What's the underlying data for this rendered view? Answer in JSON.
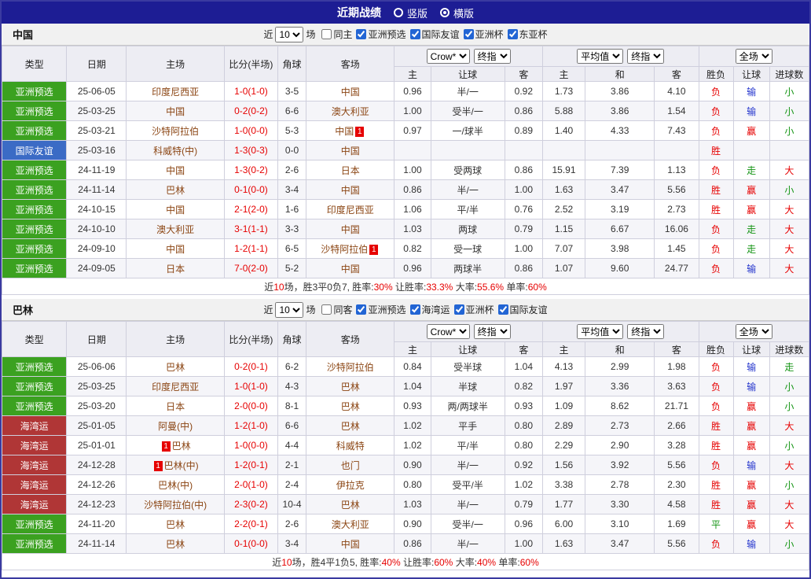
{
  "topbar": {
    "title": "近期战绩",
    "view_modes": [
      {
        "label": "竖版",
        "selected": false
      },
      {
        "label": "横版",
        "selected": true
      }
    ]
  },
  "labels": {
    "recent": "近",
    "matches": "场"
  },
  "headers": {
    "col_type": "类型",
    "col_date": "日期",
    "col_home": "主场",
    "col_score": "比分(半场)",
    "col_corner": "角球",
    "col_away": "客场",
    "odds_source": "Crow*",
    "odds_kind": "终指",
    "avg_source": "平均值",
    "avg_kind": "终指",
    "fulltime": "全场",
    "sub": [
      "主",
      "让球",
      "客",
      "主",
      "和",
      "客",
      "胜负",
      "让球",
      "进球数"
    ]
  },
  "colors": {
    "topbar_bg": "#1d1d94",
    "outer_border": "#3a3aa0",
    "header_bg": "#ededf3",
    "strip_bg": "#f1f1f1",
    "row_alt_bg": "#f5f5f9",
    "grid_line": "#cfcfdd",
    "type_green": "#3ba120",
    "type_blue": "#3b6bc5",
    "type_red": "#b03636",
    "team_link": "#8b4513",
    "score_red": "#e60000",
    "result_red": "#e60000",
    "result_blue": "#2233cc",
    "result_green": "#149414",
    "label_dark": "#333333",
    "checkbox_accent": "#2265d4"
  },
  "sections": [
    {
      "title": "中国",
      "filter": {
        "recent_count": "10",
        "options": [
          {
            "label": "同主",
            "checked": false
          },
          {
            "label": "亚洲预选",
            "checked": true
          },
          {
            "label": "国际友谊",
            "checked": true
          },
          {
            "label": "亚洲杯",
            "checked": true
          },
          {
            "label": "东亚杯",
            "checked": true
          }
        ]
      },
      "rows": [
        {
          "type": "亚洲预选",
          "type_color": "green",
          "date": "25-06-05",
          "home_name": "印度尼西亚",
          "home_rc": "",
          "score": "1-0(1-0)",
          "corner": "3-5",
          "away_name": "中国",
          "away_rc": "",
          "odds": [
            "0.96",
            "半/一",
            "0.92"
          ],
          "avg": [
            "1.73",
            "3.86",
            "4.10"
          ],
          "results": [
            [
              "负",
              "r"
            ],
            [
              "输",
              "b"
            ],
            [
              "小",
              "g"
            ]
          ]
        },
        {
          "type": "亚洲预选",
          "type_color": "green",
          "date": "25-03-25",
          "home_name": "中国",
          "home_rc": "",
          "score": "0-2(0-2)",
          "corner": "6-6",
          "away_name": "澳大利亚",
          "away_rc": "",
          "odds": [
            "1.00",
            "受半/一",
            "0.86"
          ],
          "avg": [
            "5.88",
            "3.86",
            "1.54"
          ],
          "results": [
            [
              "负",
              "r"
            ],
            [
              "输",
              "b"
            ],
            [
              "小",
              "g"
            ]
          ]
        },
        {
          "type": "亚洲预选",
          "type_color": "green",
          "date": "25-03-21",
          "home_name": "沙特阿拉伯",
          "home_rc": "",
          "score": "1-0(0-0)",
          "corner": "5-3",
          "away_name": "中国",
          "away_rc": "after",
          "odds": [
            "0.97",
            "一/球半",
            "0.89"
          ],
          "avg": [
            "1.40",
            "4.33",
            "7.43"
          ],
          "results": [
            [
              "负",
              "r"
            ],
            [
              "赢",
              "r"
            ],
            [
              "小",
              "g"
            ]
          ]
        },
        {
          "type": "国际友谊",
          "type_color": "blue",
          "date": "25-03-16",
          "home_name": "科威特(中)",
          "home_rc": "",
          "score": "1-3(0-3)",
          "corner": "0-0",
          "away_name": "中国",
          "away_rc": "",
          "odds": [
            "",
            "",
            ""
          ],
          "avg": [
            "",
            "",
            ""
          ],
          "results": [
            [
              "胜",
              "r"
            ],
            [
              "",
              ""
            ],
            [
              "",
              ""
            ]
          ]
        },
        {
          "type": "亚洲预选",
          "type_color": "green",
          "date": "24-11-19",
          "home_name": "中国",
          "home_rc": "",
          "score": "1-3(0-2)",
          "corner": "2-6",
          "away_name": "日本",
          "away_rc": "",
          "odds": [
            "1.00",
            "受两球",
            "0.86"
          ],
          "avg": [
            "15.91",
            "7.39",
            "1.13"
          ],
          "results": [
            [
              "负",
              "r"
            ],
            [
              "走",
              "g"
            ],
            [
              "大",
              "r"
            ]
          ]
        },
        {
          "type": "亚洲预选",
          "type_color": "green",
          "date": "24-11-14",
          "home_name": "巴林",
          "home_rc": "",
          "score": "0-1(0-0)",
          "corner": "3-4",
          "away_name": "中国",
          "away_rc": "",
          "odds": [
            "0.86",
            "半/一",
            "1.00"
          ],
          "avg": [
            "1.63",
            "3.47",
            "5.56"
          ],
          "results": [
            [
              "胜",
              "r"
            ],
            [
              "赢",
              "r"
            ],
            [
              "小",
              "g"
            ]
          ]
        },
        {
          "type": "亚洲预选",
          "type_color": "green",
          "date": "24-10-15",
          "home_name": "中国",
          "home_rc": "",
          "score": "2-1(2-0)",
          "corner": "1-6",
          "away_name": "印度尼西亚",
          "away_rc": "",
          "odds": [
            "1.06",
            "平/半",
            "0.76"
          ],
          "avg": [
            "2.52",
            "3.19",
            "2.73"
          ],
          "results": [
            [
              "胜",
              "r"
            ],
            [
              "赢",
              "r"
            ],
            [
              "大",
              "r"
            ]
          ]
        },
        {
          "type": "亚洲预选",
          "type_color": "green",
          "date": "24-10-10",
          "home_name": "澳大利亚",
          "home_rc": "",
          "score": "3-1(1-1)",
          "corner": "3-3",
          "away_name": "中国",
          "away_rc": "",
          "odds": [
            "1.03",
            "两球",
            "0.79"
          ],
          "avg": [
            "1.15",
            "6.67",
            "16.06"
          ],
          "results": [
            [
              "负",
              "r"
            ],
            [
              "走",
              "g"
            ],
            [
              "大",
              "r"
            ]
          ]
        },
        {
          "type": "亚洲预选",
          "type_color": "green",
          "date": "24-09-10",
          "home_name": "中国",
          "home_rc": "",
          "score": "1-2(1-1)",
          "corner": "6-5",
          "away_name": "沙特阿拉伯",
          "away_rc": "after",
          "odds": [
            "0.82",
            "受一球",
            "1.00"
          ],
          "avg": [
            "7.07",
            "3.98",
            "1.45"
          ],
          "results": [
            [
              "负",
              "r"
            ],
            [
              "走",
              "g"
            ],
            [
              "大",
              "r"
            ]
          ]
        },
        {
          "type": "亚洲预选",
          "type_color": "green",
          "date": "24-09-05",
          "home_name": "日本",
          "home_rc": "",
          "score": "7-0(2-0)",
          "corner": "5-2",
          "away_name": "中国",
          "away_rc": "",
          "odds": [
            "0.96",
            "两球半",
            "0.86"
          ],
          "avg": [
            "1.07",
            "9.60",
            "24.77"
          ],
          "results": [
            [
              "负",
              "r"
            ],
            [
              "输",
              "b"
            ],
            [
              "大",
              "r"
            ]
          ]
        }
      ],
      "summary": [
        {
          "text": "近",
          "color": "#333333"
        },
        {
          "text": "10",
          "color": "#e60000"
        },
        {
          "text": "场，胜3平0负7, 胜率:",
          "color": "#333333"
        },
        {
          "text": "30%",
          "color": "#e60000"
        },
        {
          "text": " 让胜率:",
          "color": "#333333"
        },
        {
          "text": "33.3%",
          "color": "#e60000"
        },
        {
          "text": " 大率:",
          "color": "#333333"
        },
        {
          "text": "55.6%",
          "color": "#e60000"
        },
        {
          "text": " 单率:",
          "color": "#333333"
        },
        {
          "text": "60%",
          "color": "#e60000"
        }
      ]
    },
    {
      "title": "巴林",
      "filter": {
        "recent_count": "10",
        "options": [
          {
            "label": "同客",
            "checked": false
          },
          {
            "label": "亚洲预选",
            "checked": true
          },
          {
            "label": "海湾运",
            "checked": true
          },
          {
            "label": "亚洲杯",
            "checked": true
          },
          {
            "label": "国际友谊",
            "checked": true
          }
        ]
      },
      "rows": [
        {
          "type": "亚洲预选",
          "type_color": "green",
          "date": "25-06-06",
          "home_name": "巴林",
          "home_rc": "",
          "score": "0-2(0-1)",
          "corner": "6-2",
          "away_name": "沙特阿拉伯",
          "away_rc": "",
          "odds": [
            "0.84",
            "受半球",
            "1.04"
          ],
          "avg": [
            "4.13",
            "2.99",
            "1.98"
          ],
          "results": [
            [
              "负",
              "r"
            ],
            [
              "输",
              "b"
            ],
            [
              "走",
              "g"
            ]
          ]
        },
        {
          "type": "亚洲预选",
          "type_color": "green",
          "date": "25-03-25",
          "home_name": "印度尼西亚",
          "home_rc": "",
          "score": "1-0(1-0)",
          "corner": "4-3",
          "away_name": "巴林",
          "away_rc": "",
          "odds": [
            "1.04",
            "半球",
            "0.82"
          ],
          "avg": [
            "1.97",
            "3.36",
            "3.63"
          ],
          "results": [
            [
              "负",
              "r"
            ],
            [
              "输",
              "b"
            ],
            [
              "小",
              "g"
            ]
          ]
        },
        {
          "type": "亚洲预选",
          "type_color": "green",
          "date": "25-03-20",
          "home_name": "日本",
          "home_rc": "",
          "score": "2-0(0-0)",
          "corner": "8-1",
          "away_name": "巴林",
          "away_rc": "",
          "odds": [
            "0.93",
            "两/两球半",
            "0.93"
          ],
          "avg": [
            "1.09",
            "8.62",
            "21.71"
          ],
          "results": [
            [
              "负",
              "r"
            ],
            [
              "赢",
              "r"
            ],
            [
              "小",
              "g"
            ]
          ]
        },
        {
          "type": "海湾运",
          "type_color": "red",
          "date": "25-01-05",
          "home_name": "阿曼(中)",
          "home_rc": "",
          "score": "1-2(1-0)",
          "corner": "6-6",
          "away_name": "巴林",
          "away_rc": "",
          "odds": [
            "1.02",
            "平手",
            "0.80"
          ],
          "avg": [
            "2.89",
            "2.73",
            "2.66"
          ],
          "results": [
            [
              "胜",
              "r"
            ],
            [
              "赢",
              "r"
            ],
            [
              "大",
              "r"
            ]
          ]
        },
        {
          "type": "海湾运",
          "type_color": "red",
          "date": "25-01-01",
          "home_name": "巴林",
          "home_rc": "before",
          "score": "1-0(0-0)",
          "corner": "4-4",
          "away_name": "科威特",
          "away_rc": "",
          "odds": [
            "1.02",
            "平/半",
            "0.80"
          ],
          "avg": [
            "2.29",
            "2.90",
            "3.28"
          ],
          "results": [
            [
              "胜",
              "r"
            ],
            [
              "赢",
              "r"
            ],
            [
              "小",
              "g"
            ]
          ]
        },
        {
          "type": "海湾运",
          "type_color": "red",
          "date": "24-12-28",
          "home_name": "巴林(中)",
          "home_rc": "before",
          "score": "1-2(0-1)",
          "corner": "2-1",
          "away_name": "也门",
          "away_rc": "",
          "odds": [
            "0.90",
            "半/一",
            "0.92"
          ],
          "avg": [
            "1.56",
            "3.92",
            "5.56"
          ],
          "results": [
            [
              "负",
              "r"
            ],
            [
              "输",
              "b"
            ],
            [
              "大",
              "r"
            ]
          ]
        },
        {
          "type": "海湾运",
          "type_color": "red",
          "date": "24-12-26",
          "home_name": "巴林(中)",
          "home_rc": "",
          "score": "2-0(1-0)",
          "corner": "2-4",
          "away_name": "伊拉克",
          "away_rc": "",
          "odds": [
            "0.80",
            "受平/半",
            "1.02"
          ],
          "avg": [
            "3.38",
            "2.78",
            "2.30"
          ],
          "results": [
            [
              "胜",
              "r"
            ],
            [
              "赢",
              "r"
            ],
            [
              "小",
              "g"
            ]
          ]
        },
        {
          "type": "海湾运",
          "type_color": "red",
          "date": "24-12-23",
          "home_name": "沙特阿拉伯(中)",
          "home_rc": "",
          "score": "2-3(0-2)",
          "corner": "10-4",
          "away_name": "巴林",
          "away_rc": "",
          "odds": [
            "1.03",
            "半/一",
            "0.79"
          ],
          "avg": [
            "1.77",
            "3.30",
            "4.58"
          ],
          "results": [
            [
              "胜",
              "r"
            ],
            [
              "赢",
              "r"
            ],
            [
              "大",
              "r"
            ]
          ]
        },
        {
          "type": "亚洲预选",
          "type_color": "green",
          "date": "24-11-20",
          "home_name": "巴林",
          "home_rc": "",
          "score": "2-2(0-1)",
          "corner": "2-6",
          "away_name": "澳大利亚",
          "away_rc": "",
          "odds": [
            "0.90",
            "受半/一",
            "0.96"
          ],
          "avg": [
            "6.00",
            "3.10",
            "1.69"
          ],
          "results": [
            [
              "平",
              "g"
            ],
            [
              "赢",
              "r"
            ],
            [
              "大",
              "r"
            ]
          ]
        },
        {
          "type": "亚洲预选",
          "type_color": "green",
          "date": "24-11-14",
          "home_name": "巴林",
          "home_rc": "",
          "score": "0-1(0-0)",
          "corner": "3-4",
          "away_name": "中国",
          "away_rc": "",
          "odds": [
            "0.86",
            "半/一",
            "1.00"
          ],
          "avg": [
            "1.63",
            "3.47",
            "5.56"
          ],
          "results": [
            [
              "负",
              "r"
            ],
            [
              "输",
              "b"
            ],
            [
              "小",
              "g"
            ]
          ]
        }
      ],
      "summary": [
        {
          "text": "近",
          "color": "#333333"
        },
        {
          "text": "10",
          "color": "#e60000"
        },
        {
          "text": "场，胜4平1负5, 胜率:",
          "color": "#333333"
        },
        {
          "text": "40%",
          "color": "#e60000"
        },
        {
          "text": " 让胜率:",
          "color": "#333333"
        },
        {
          "text": "60%",
          "color": "#e60000"
        },
        {
          "text": " 大率:",
          "color": "#333333"
        },
        {
          "text": "40%",
          "color": "#e60000"
        },
        {
          "text": " 单率:",
          "color": "#333333"
        },
        {
          "text": "60%",
          "color": "#e60000"
        }
      ]
    }
  ]
}
